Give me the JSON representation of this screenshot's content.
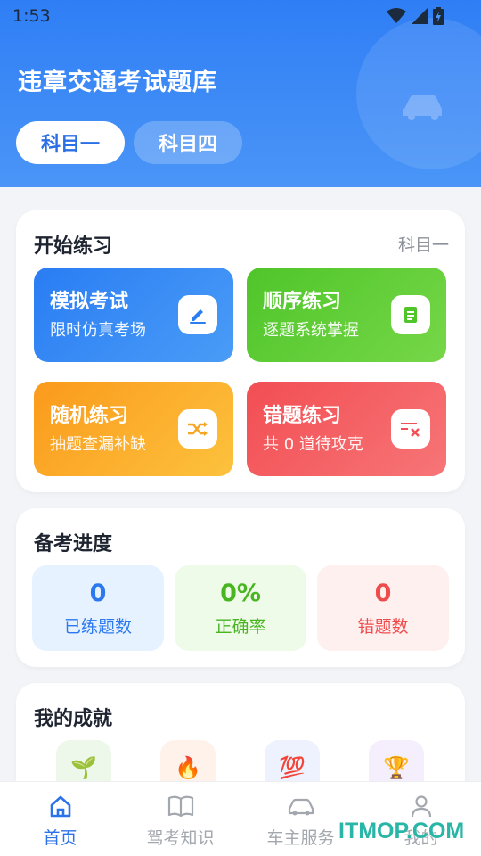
{
  "status_bar": {
    "time": "1:53"
  },
  "header": {
    "title": "违章交通考试题库",
    "tabs": [
      {
        "label": "科目一",
        "active": true
      },
      {
        "label": "科目四",
        "active": false
      }
    ]
  },
  "practice": {
    "title": "开始练习",
    "subject": "科目一",
    "tiles": [
      {
        "title": "模拟考试",
        "desc": "限时仿真考场",
        "icon": "pencil-icon",
        "color": "#2a7df3"
      },
      {
        "title": "顺序练习",
        "desc": "逐题系统掌握",
        "icon": "document-icon",
        "color": "#4fc52a"
      },
      {
        "title": "随机练习",
        "desc": "抽题查漏补缺",
        "icon": "shuffle-icon",
        "color": "#fb9a1c"
      },
      {
        "title": "错题练习",
        "desc": "共 0 道待攻克",
        "icon": "wrong-list-icon",
        "color": "#f24e53"
      }
    ]
  },
  "progress": {
    "title": "备考进度",
    "stats": [
      {
        "value": "0",
        "label": "已练题数"
      },
      {
        "value": "0%",
        "label": "正确率"
      },
      {
        "value": "0",
        "label": "错题数"
      }
    ]
  },
  "achievements": {
    "title": "我的成就",
    "badges": [
      "🌱",
      "🔥",
      "💯",
      "🏆"
    ]
  },
  "bottom_nav": [
    {
      "label": "首页",
      "active": true
    },
    {
      "label": "驾考知识",
      "active": false
    },
    {
      "label": "车主服务",
      "active": false
    },
    {
      "label": "我的",
      "active": false
    }
  ],
  "watermark": "ITMOP.COM",
  "colors": {
    "primary": "#2b72ea",
    "background": "#f2f4f8"
  }
}
